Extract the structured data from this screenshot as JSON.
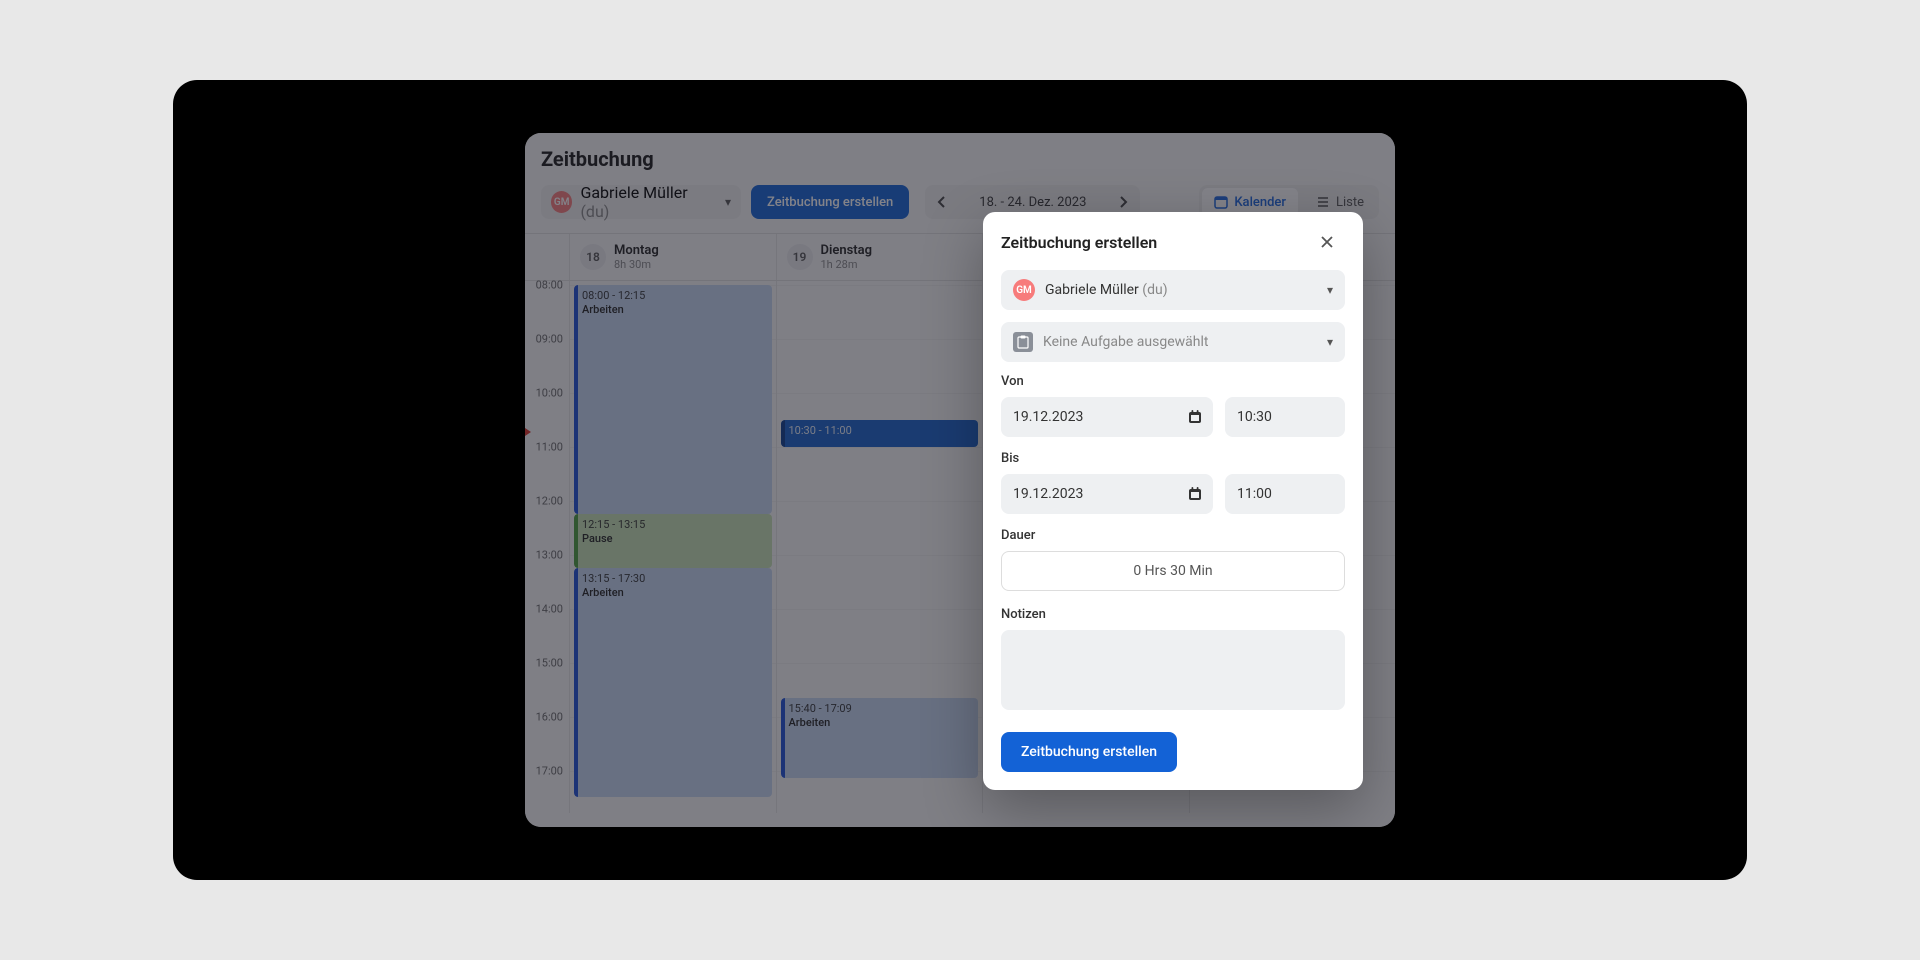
{
  "page_title": "Zeitbuchung",
  "user": {
    "initials": "GM",
    "name": "Gabriele Müller",
    "suffix": "(du)"
  },
  "create_button": "Zeitbuchung erstellen",
  "date_range": "18. - 24. Dez. 2023",
  "view": {
    "calendar": "Kalender",
    "list": "Liste"
  },
  "hours": [
    "08:00",
    "09:00",
    "10:00",
    "11:00",
    "12:00",
    "13:00",
    "14:00",
    "15:00",
    "16:00",
    "17:00"
  ],
  "days": {
    "mon": {
      "num": "18",
      "name": "Montag",
      "dur": "8h 30m"
    },
    "tue": {
      "num": "19",
      "name": "Dienstag",
      "dur": "1h 28m"
    }
  },
  "events": {
    "mon1": {
      "time": "08:00 - 12:15",
      "title": "Arbeiten"
    },
    "mon2": {
      "time": "12:15 - 13:15",
      "title": "Pause"
    },
    "mon3": {
      "time": "13:15 - 17:30",
      "title": "Arbeiten"
    },
    "tue1": {
      "time": "10:30 - 11:00",
      "title": ""
    },
    "tue2": {
      "time": "15:40 - 17:09",
      "title": "Arbeiten"
    }
  },
  "dialog": {
    "title": "Zeitbuchung erstellen",
    "user_name": "Gabriele Müller",
    "user_suffix": "(du)",
    "task_placeholder": "Keine Aufgabe ausgewählt",
    "from_label": "Von",
    "from_date": "19.12.2023",
    "from_time": "10:30",
    "to_label": "Bis",
    "to_date": "19.12.2023",
    "to_time": "11:00",
    "duration_label": "Dauer",
    "duration_value": "0 Hrs 30 Min",
    "notes_label": "Notizen",
    "submit": "Zeitbuchung erstellen"
  }
}
